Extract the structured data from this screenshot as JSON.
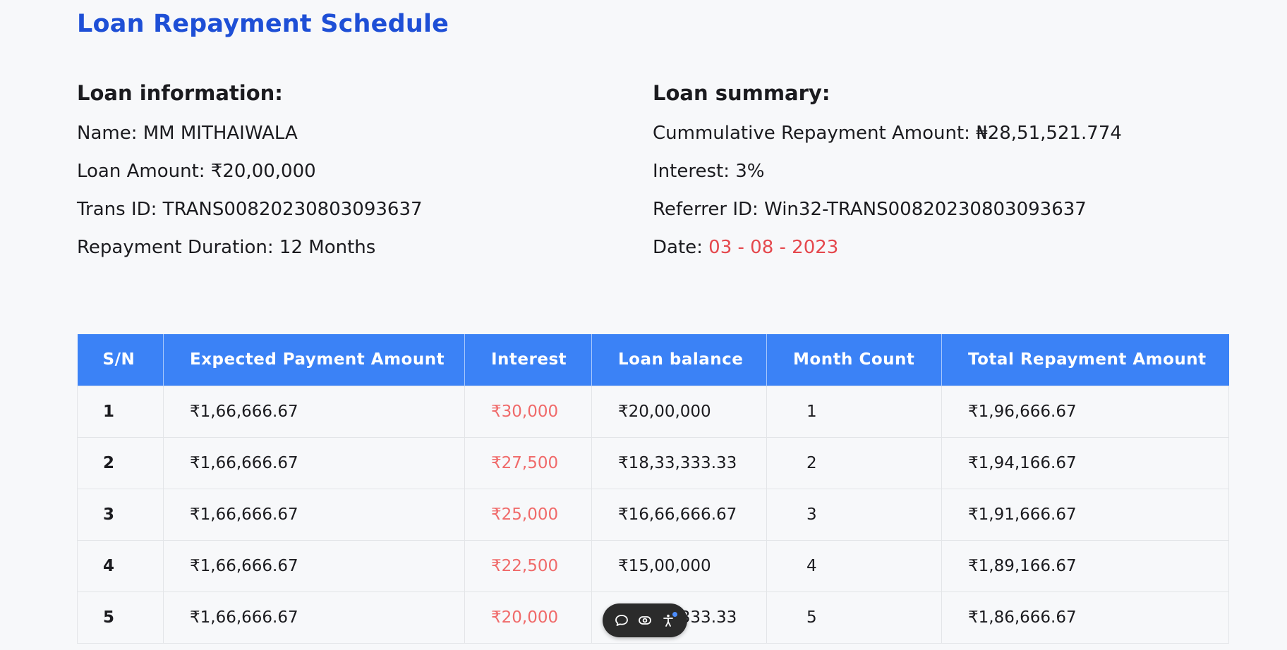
{
  "page": {
    "title": "Loan Repayment Schedule"
  },
  "loan_information": {
    "heading": "Loan information:",
    "name": "Name: MM MITHAIWALA",
    "loan_amount": "Loan Amount: ₹20,00,000",
    "trans_id": "Trans ID: TRANS00820230803093637",
    "duration": "Repayment Duration: 12 Months"
  },
  "loan_summary": {
    "heading": "Loan summary:",
    "cumulative": "Cummulative Repayment Amount: ₦28,51,521.774",
    "interest": "Interest: 3%",
    "referrer_id": "Referrer ID: Win32-TRANS00820230803093637",
    "date_label": "Date:",
    "date_value": "03 - 08 - 2023"
  },
  "table": {
    "headers": {
      "sn": "S/N",
      "expected": "Expected Payment Amount",
      "interest": "Interest",
      "balance": "Loan balance",
      "month": "Month Count",
      "total": "Total Repayment Amount"
    },
    "rows": [
      {
        "sn": "1",
        "expected": "₹1,66,666.67",
        "interest": "₹30,000",
        "balance": "₹20,00,000",
        "month": "1",
        "total": "₹1,96,666.67"
      },
      {
        "sn": "2",
        "expected": "₹1,66,666.67",
        "interest": "₹27,500",
        "balance": "₹18,33,333.33",
        "month": "2",
        "total": "₹1,94,166.67"
      },
      {
        "sn": "3",
        "expected": "₹1,66,666.67",
        "interest": "₹25,000",
        "balance": "₹16,66,666.67",
        "month": "3",
        "total": "₹1,91,666.67"
      },
      {
        "sn": "4",
        "expected": "₹1,66,666.67",
        "interest": "₹22,500",
        "balance": "₹15,00,000",
        "month": "4",
        "total": "₹1,89,166.67"
      },
      {
        "sn": "5",
        "expected": "₹1,66,666.67",
        "interest": "₹20,000",
        "balance": "₹13,33,333.33",
        "month": "5",
        "total": "₹1,86,666.67"
      }
    ]
  },
  "toolbar": {
    "icons": [
      "chat-bubble-icon",
      "eye-icon",
      "accessibility-icon"
    ]
  },
  "colors": {
    "title": "#1e4fd6",
    "header_bg": "#3b82f6",
    "interest_text": "#f06a6a",
    "date_text": "#e5484d"
  }
}
